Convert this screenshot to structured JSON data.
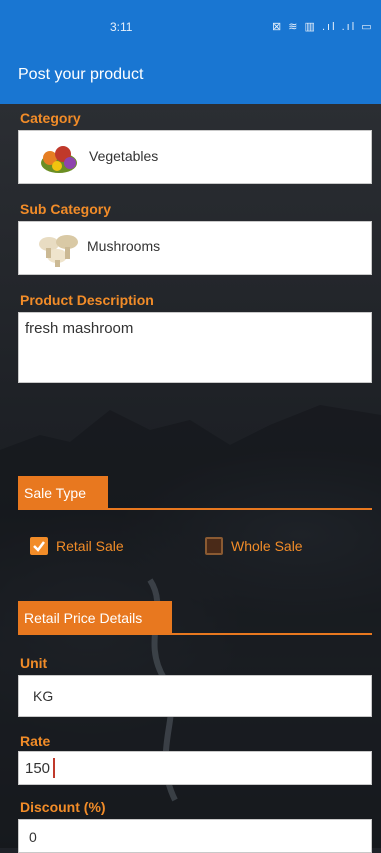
{
  "status": {
    "time": "3:11",
    "icons": "⊠ ≋ ▥ .ıl .ıl ▭"
  },
  "appbar": {
    "title": "Post your product"
  },
  "category": {
    "label": "Category",
    "value": "Vegetables",
    "icon": "vegetables-icon"
  },
  "sub_category": {
    "label": "Sub Category",
    "value": "Mushrooms",
    "icon": "mushrooms-icon"
  },
  "description": {
    "label": "Product Description",
    "value": "fresh mashroom"
  },
  "sale_type": {
    "header": "Sale Type",
    "options": [
      {
        "label": "Retail Sale",
        "checked": true
      },
      {
        "label": "Whole Sale",
        "checked": false
      }
    ]
  },
  "retail": {
    "header": "Retail Price Details",
    "unit": {
      "label": "Unit",
      "value": "KG"
    },
    "rate": {
      "label": "Rate",
      "value": "150"
    },
    "discount": {
      "label": "Discount (%)",
      "value": "0"
    }
  },
  "colors": {
    "accent": "#f28c28",
    "appbar": "#1976d2"
  }
}
